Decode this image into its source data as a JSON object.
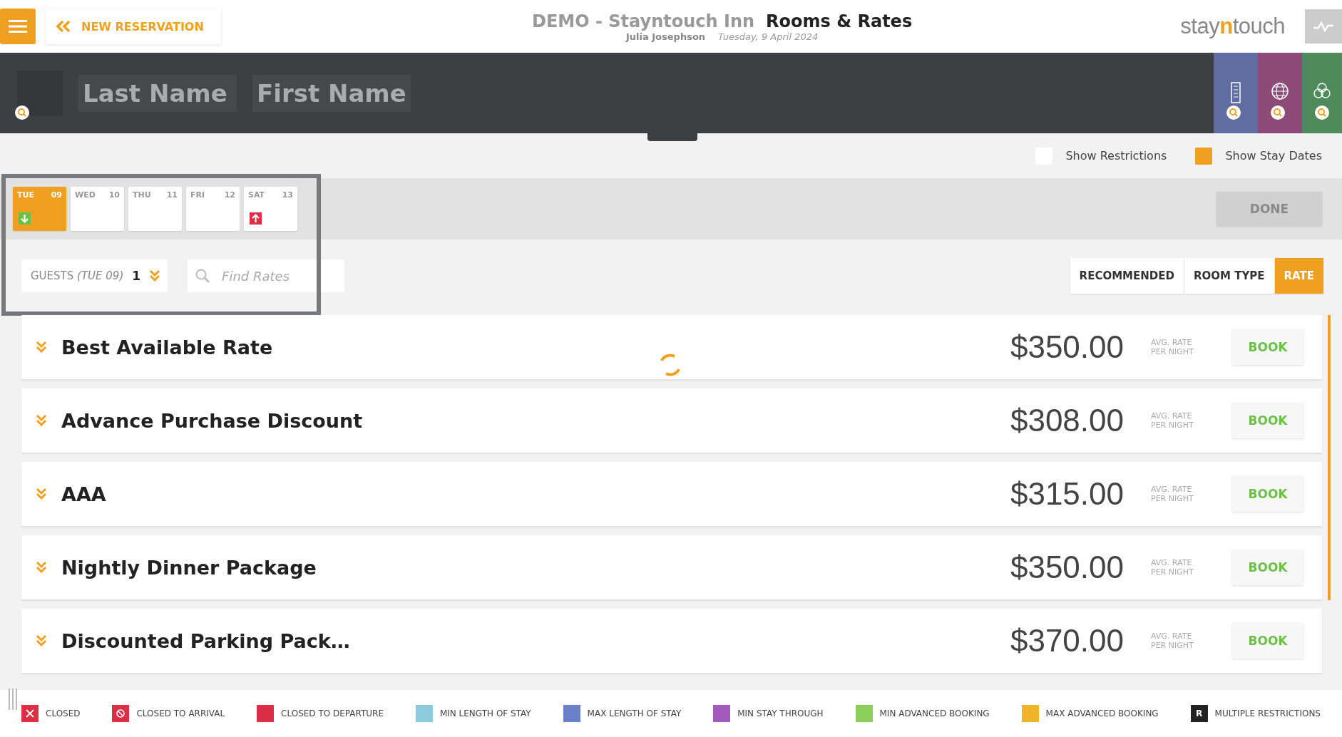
{
  "header": {
    "back_button": "NEW RESERVATION",
    "hotel": "DEMO - Stayntouch Inn",
    "title": "Rooms & Rates",
    "user": "Julia Josephson",
    "date": "Tuesday, 9 April 2024",
    "logo": "stay**n**touch"
  },
  "guest_search": {
    "last_name_placeholder": "Last Name",
    "first_name_placeholder": "First Name"
  },
  "options": [
    {
      "label": "Show Restrictions",
      "checked": false
    },
    {
      "label": "Show Stay Dates",
      "checked": true
    }
  ],
  "dates": [
    {
      "day": "TUE",
      "num": "09",
      "selected": true,
      "arrival": true,
      "departure": false
    },
    {
      "day": "WED",
      "num": "10",
      "selected": false,
      "arrival": false,
      "departure": false
    },
    {
      "day": "THU",
      "num": "11",
      "selected": false,
      "arrival": false,
      "departure": false
    },
    {
      "day": "FRI",
      "num": "12",
      "selected": false,
      "arrival": false,
      "departure": false
    },
    {
      "day": "SAT",
      "num": "13",
      "selected": false,
      "arrival": false,
      "departure": true
    }
  ],
  "done_button": {
    "label": "DONE",
    "disabled": true
  },
  "guests": {
    "label": "GUESTS",
    "day": "(TUE 09)",
    "count": "1"
  },
  "find_rates": {
    "placeholder": "Find Rates"
  },
  "sort_tabs": [
    {
      "label": "RECOMMENDED",
      "selected": false
    },
    {
      "label": "ROOM TYPE",
      "selected": false
    },
    {
      "label": "RATE",
      "selected": true
    }
  ],
  "rates": [
    {
      "name": "Best Available Rate",
      "price": "$350.00",
      "note_1": "AVG. RATE",
      "note_2": "PER NIGHT",
      "button": "BOOK"
    },
    {
      "name": "Advance Purchase Discount",
      "price": "$308.00",
      "note_1": "AVG. RATE",
      "note_2": "PER NIGHT",
      "button": "BOOK"
    },
    {
      "name": "AAA",
      "price": "$315.00",
      "note_1": "AVG. RATE",
      "note_2": "PER NIGHT",
      "button": "BOOK"
    },
    {
      "name": "Nightly Dinner Package",
      "price": "$350.00",
      "note_1": "AVG. RATE",
      "note_2": "PER NIGHT",
      "button": "BOOK"
    },
    {
      "name": "Discounted Parking Pack…",
      "price": "$370.00",
      "note_1": "AVG. RATE",
      "note_2": "PER NIGHT",
      "button": "BOOK"
    }
  ],
  "legend": [
    {
      "label": "CLOSED",
      "kind": "cross",
      "color": "#dc2f45"
    },
    {
      "label": "CLOSED TO ARRIVAL",
      "kind": "prohibit",
      "color": "#dc2f45"
    },
    {
      "label": "CLOSED TO DEPARTURE",
      "kind": "plain",
      "color": "#dc2f45"
    },
    {
      "label": "MIN LENGTH OF STAY",
      "kind": "plain",
      "color": "#8ccbdd"
    },
    {
      "label": "MAX LENGTH OF STAY",
      "kind": "plain",
      "color": "#6a80c8"
    },
    {
      "label": "MIN STAY THROUGH",
      "kind": "plain",
      "color": "#a25bbd"
    },
    {
      "label": "MIN ADVANCED BOOKING",
      "kind": "plain",
      "color": "#8bcf5a"
    },
    {
      "label": "MAX ADVANCED BOOKING",
      "kind": "plain",
      "color": "#f0b429"
    },
    {
      "label": "MULTIPLE RESTRICTIONS",
      "kind": "letter",
      "letter": "R",
      "color": "#222222"
    }
  ]
}
